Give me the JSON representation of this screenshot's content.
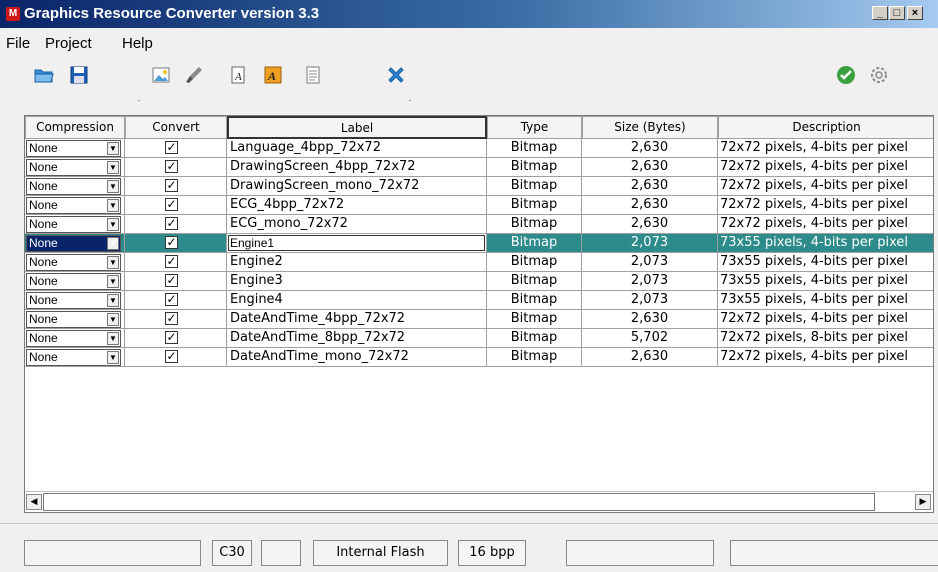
{
  "window": {
    "title": "Graphics Resource Converter version 3.3",
    "logo": "M",
    "minimize": "_",
    "maximize": "□",
    "close": "×"
  },
  "menu": [
    "File",
    "Project",
    "Help"
  ],
  "toolbar": {
    "icons": [
      "open-folder-icon",
      "save-icon",
      "bitmap-icon",
      "brush-icon",
      "font-icon",
      "font-alt-icon",
      "list-icon",
      "delete-icon",
      "check-icon",
      "settings-icon"
    ],
    "accent_blue": "#2e7fd6",
    "check_green": "#3aa040"
  },
  "table": {
    "columns": [
      "Compression",
      "Convert",
      "Label",
      "Type",
      "Size (Bytes)",
      "Description"
    ],
    "rows": [
      {
        "compression": "None",
        "convert": true,
        "label": "Language_4bpp_72x72",
        "type": "Bitmap",
        "size": "2,630",
        "description": "72x72 pixels, 4-bits per pixel"
      },
      {
        "compression": "None",
        "convert": true,
        "label": "DrawingScreen_4bpp_72x72",
        "type": "Bitmap",
        "size": "2,630",
        "description": "72x72 pixels, 4-bits per pixel"
      },
      {
        "compression": "None",
        "convert": true,
        "label": "DrawingScreen_mono_72x72",
        "type": "Bitmap",
        "size": "2,630",
        "description": "72x72 pixels, 4-bits per pixel"
      },
      {
        "compression": "None",
        "convert": true,
        "label": "ECG_4bpp_72x72",
        "type": "Bitmap",
        "size": "2,630",
        "description": "72x72 pixels, 4-bits per pixel"
      },
      {
        "compression": "None",
        "convert": true,
        "label": "ECG_mono_72x72",
        "type": "Bitmap",
        "size": "2,630",
        "description": "72x72 pixels, 4-bits per pixel"
      },
      {
        "compression": "None",
        "convert": true,
        "label": "Engine1",
        "type": "Bitmap",
        "size": "2,073",
        "description": "73x55 pixels, 4-bits per pixel",
        "selected": true
      },
      {
        "compression": "None",
        "convert": true,
        "label": "Engine2",
        "type": "Bitmap",
        "size": "2,073",
        "description": "73x55 pixels, 4-bits per pixel"
      },
      {
        "compression": "None",
        "convert": true,
        "label": "Engine3",
        "type": "Bitmap",
        "size": "2,073",
        "description": "73x55 pixels, 4-bits per pixel"
      },
      {
        "compression": "None",
        "convert": true,
        "label": "Engine4",
        "type": "Bitmap",
        "size": "2,073",
        "description": "73x55 pixels, 4-bits per pixel"
      },
      {
        "compression": "None",
        "convert": true,
        "label": "DateAndTime_4bpp_72x72",
        "type": "Bitmap",
        "size": "2,630",
        "description": "72x72 pixels, 4-bits per pixel"
      },
      {
        "compression": "None",
        "convert": true,
        "label": "DateAndTime_8bpp_72x72",
        "type": "Bitmap",
        "size": "5,702",
        "description": "72x72 pixels, 8-bits per pixel"
      },
      {
        "compression": "None",
        "convert": true,
        "label": "DateAndTime_mono_72x72",
        "type": "Bitmap",
        "size": "2,630",
        "description": "72x72 pixels, 4-bits per pixel"
      }
    ],
    "selection_color": "#2e8b8b",
    "checkmark": "✓",
    "dropdown_arrow": "▼"
  },
  "scrollbar": {
    "left": "◀",
    "right": "▶"
  },
  "statusbar": [
    "",
    "C30",
    "",
    "Internal Flash",
    "16 bpp",
    "",
    ""
  ]
}
